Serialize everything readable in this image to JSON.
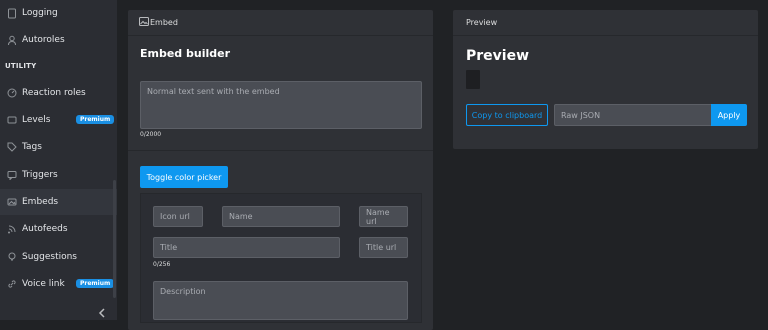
{
  "sidebar": {
    "items_top": [
      {
        "label": "Logging",
        "icon": "document-icon"
      },
      {
        "label": "Autoroles",
        "icon": "user-icon"
      }
    ],
    "section_label": "UTILITY",
    "items": [
      {
        "label": "Reaction roles",
        "icon": "gauge-icon",
        "badge": ""
      },
      {
        "label": "Levels",
        "icon": "chart-icon",
        "badge": "Premium"
      },
      {
        "label": "Tags",
        "icon": "tag-icon",
        "badge": ""
      },
      {
        "label": "Triggers",
        "icon": "message-icon",
        "badge": ""
      },
      {
        "label": "Embeds",
        "icon": "embed-icon",
        "badge": ""
      },
      {
        "label": "Autofeeds",
        "icon": "rss-icon",
        "badge": ""
      },
      {
        "label": "Suggestions",
        "icon": "lightbulb-icon",
        "badge": ""
      },
      {
        "label": "Voice link",
        "icon": "link-icon",
        "badge": "Premium"
      }
    ],
    "active_item": "Embeds"
  },
  "embed_panel": {
    "tab_label": "Embed",
    "title": "Embed builder",
    "content_placeholder": "Normal text sent with the embed",
    "content_counter": "0/2000",
    "toggle_color_label": "Toggle color picker",
    "icon_url_placeholder": "Icon url",
    "name_placeholder": "Name",
    "name_url_placeholder": "Name url",
    "title_placeholder": "Title",
    "title_url_placeholder": "Title url",
    "title_counter": "0/256",
    "description_placeholder": "Description"
  },
  "preview_panel": {
    "tab_label": "Preview",
    "title": "Preview",
    "copy_label": "Copy to clipboard",
    "raw_json_placeholder": "Raw JSON",
    "apply_label": "Apply"
  },
  "colors": {
    "accent": "#0e98f0",
    "panel": "#2f3136",
    "sidebar": "#2b2d33",
    "background": "#202225"
  }
}
